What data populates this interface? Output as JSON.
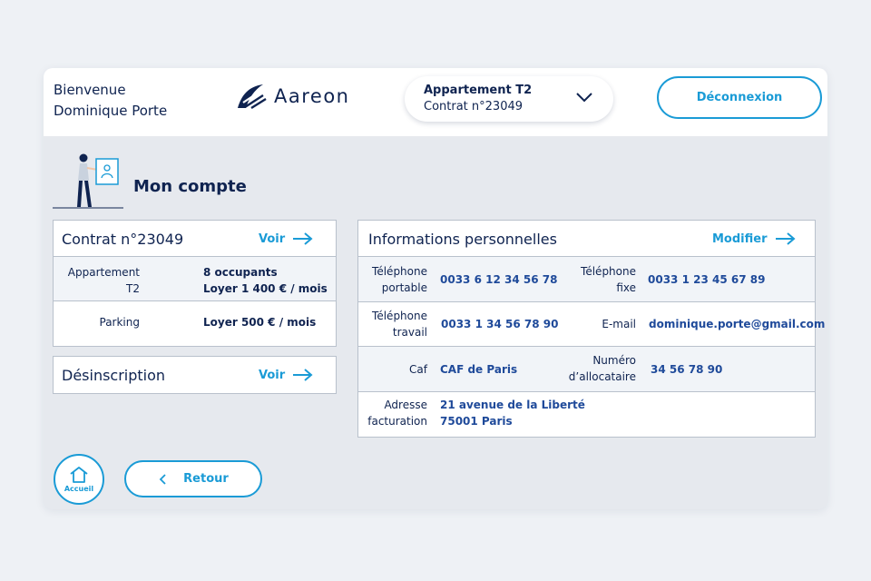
{
  "header": {
    "welcome_line1": "Bienvenue",
    "welcome_line2": "Dominique Porte",
    "logo_text": "Aareon",
    "selector": {
      "line1": "Appartement T2",
      "line2": "Contrat n°23049"
    },
    "logout_label": "Déconnexion"
  },
  "page": {
    "title": "Mon compte"
  },
  "contract_card": {
    "title": "Contrat n°23049",
    "link_label": "Voir",
    "rows": [
      {
        "label_line1": "Appartement",
        "label_line2": "T2",
        "value_line1": "8 occupants",
        "value_line2": "Loyer 1 400 € / mois"
      },
      {
        "label_line1": "Parking",
        "value_line1": "Loyer 500 € / mois"
      }
    ]
  },
  "unsubscribe_card": {
    "title": "Désinscription",
    "link_label": "Voir"
  },
  "personal_card": {
    "title": "Informations personnelles",
    "link_label": "Modifier",
    "rows": [
      {
        "label1_line1": "Téléphone",
        "label1_line2": "portable",
        "value1": "0033 6 12 34 56 78",
        "label2_line1": "Téléphone",
        "label2_line2": "fixe",
        "value2": "0033 1 23 45 67 89"
      },
      {
        "label1_line1": "Téléphone",
        "label1_line2": "travail",
        "value1": "0033 1 34 56 78 90",
        "label2_line1": "E-mail",
        "value2": "dominique.porte@gmail.com"
      },
      {
        "label1_line1": "Caf",
        "value1": "CAF de Paris",
        "label2_line1": "Numéro",
        "label2_line2": "d’allocataire",
        "value2": "34 56 78 90"
      },
      {
        "label1_line1": "Adresse",
        "label1_line2": "facturation",
        "value1_line1": "21 avenue de la Liberté",
        "value1_line2": "75001 Paris"
      }
    ]
  },
  "footer": {
    "home_label": "Accueil",
    "back_label": "Retour"
  },
  "colors": {
    "accent": "#1a9bd6",
    "navy": "#0f2350",
    "value_blue": "#1f4a9a",
    "border": "#b9c1cc",
    "row_alt": "#f1f4f8",
    "content_bg": "#e6e9ee"
  },
  "icons": [
    "aareon-logo-icon",
    "chevron-down-icon",
    "person-with-card-illustration",
    "arrow-right-icon",
    "home-icon",
    "chevron-left-icon"
  ]
}
